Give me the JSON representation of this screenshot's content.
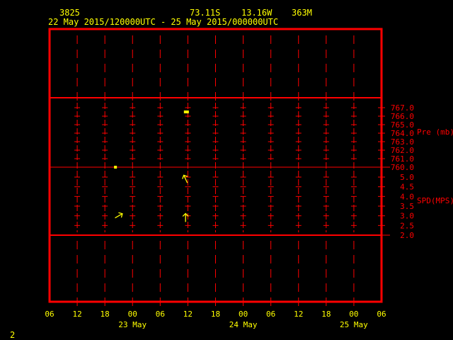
{
  "header": {
    "station": "3825",
    "lat": "73.11S",
    "lon": "13.16W",
    "elev": "363M",
    "time_range": "22 May 2015/120000UTC - 25 May 2015/000000UTC"
  },
  "footer": {
    "page": "2"
  },
  "colors": {
    "frame": "#ff0000",
    "text": "#ffff00",
    "axis_text": "#ff0000",
    "data": "#ffff00"
  },
  "chart_data": {
    "type": "meteogram",
    "x_ticks": [
      "06",
      "12",
      "18",
      "00",
      "06",
      "12",
      "18",
      "00",
      "06",
      "12",
      "18",
      "00",
      "06"
    ],
    "date_labels": [
      {
        "label": "23 May",
        "tick_index": 3
      },
      {
        "label": "24 May",
        "tick_index": 7
      },
      {
        "label": "25 May",
        "tick_index": 11
      }
    ],
    "panels": [
      {
        "name": "pressure",
        "ylabel": "Pre (mb)",
        "ylim": [
          760.0,
          767.0
        ],
        "ticks": [
          "767.0",
          "766.0",
          "765.0",
          "764.0",
          "763.0",
          "762.0",
          "761.0",
          "760.0"
        ],
        "points": [
          {
            "hours_from_start": 14.3,
            "value": 760.0
          },
          {
            "hours_from_start": 29.6,
            "value": 766.5
          }
        ]
      },
      {
        "name": "wind_speed",
        "ylabel": "SPD(MPS)",
        "ylim": [
          2.0,
          5.0
        ],
        "ticks": [
          "5.0",
          "4.5",
          "4.0",
          "3.5",
          "3.0",
          "2.5",
          "2.0"
        ],
        "arrows": [
          {
            "hours_from_start": 15.0,
            "value": 3.0,
            "direction_deg": 60
          },
          {
            "hours_from_start": 29.5,
            "value": 4.9,
            "direction_deg": -25
          },
          {
            "hours_from_start": 29.5,
            "value": 2.9,
            "direction_deg": 0
          }
        ]
      }
    ]
  }
}
